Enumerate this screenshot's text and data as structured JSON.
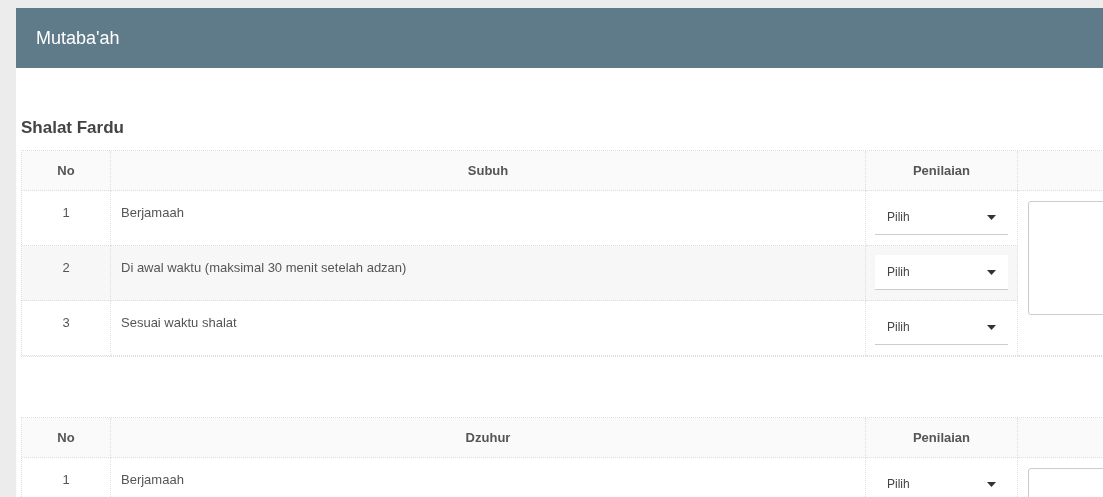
{
  "header": {
    "title": "Mutaba'ah"
  },
  "section": {
    "title": "Shalat Fardu"
  },
  "tables": [
    {
      "columns": [
        "No",
        "Subuh",
        "Penilaian"
      ],
      "rows": [
        {
          "no": "1",
          "item": "Berjamaah",
          "rating": "Pilih"
        },
        {
          "no": "2",
          "item": "Di awal waktu (maksimal 30 menit setelah adzan)",
          "rating": "Pilih"
        },
        {
          "no": "3",
          "item": "Sesuai waktu shalat",
          "rating": "Pilih"
        }
      ]
    },
    {
      "columns": [
        "No",
        "Dzuhur",
        "Penilaian"
      ],
      "rows": [
        {
          "no": "1",
          "item": "Berjamaah",
          "rating": "Pilih"
        }
      ]
    }
  ]
}
